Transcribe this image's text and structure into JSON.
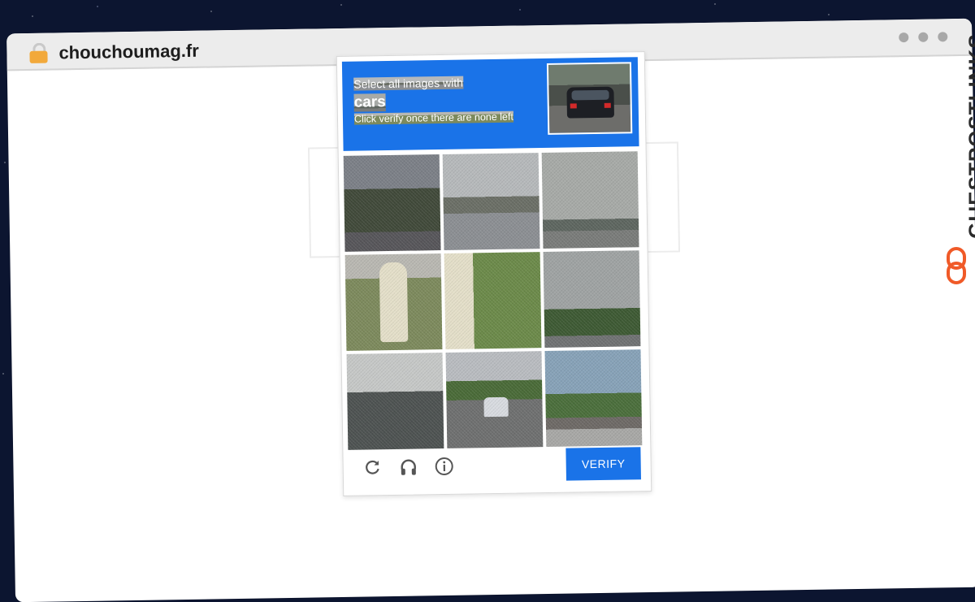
{
  "browser": {
    "domain": "chouchoumag.fr"
  },
  "captcha": {
    "instruction": "Select all images with",
    "target": "cars",
    "hint": "Click verify once there are none left",
    "verify_label": "VERIFY",
    "footer_icons": [
      "reload-icon",
      "headphones-icon",
      "info-icon"
    ]
  },
  "watermark": {
    "text": "GUESTPOSTLINKS"
  },
  "colors": {
    "accent": "#1a73e8",
    "logo": "#f05a28"
  }
}
